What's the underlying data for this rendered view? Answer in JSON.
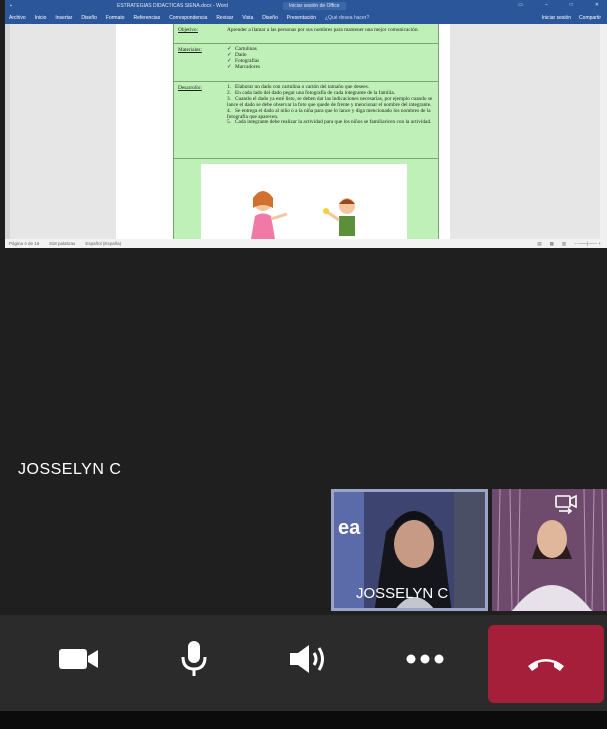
{
  "word": {
    "doc_title": "ESTRATEGIAS DIDACTICAS SIENA.docx - Word",
    "search_hint": "Iniciar sesión de Office",
    "tabs": [
      "Archivo",
      "Inicio",
      "Insertar",
      "Diseño",
      "Formato",
      "Referencias",
      "Correspondencia",
      "Revisar",
      "Vista",
      "Diseño",
      "Presentación"
    ],
    "tell_me": "¿Qué desea hacer?",
    "user_btn": "Iniciar sesión",
    "share_btn": "Compartir",
    "table": {
      "objective_label": "Objetivo:",
      "objective_text": "Aprender a llamar a las personas por sus nombres para mantener una mejor comunicación.",
      "materials_label": "Materiales:",
      "materials": [
        "Cartulinas",
        "Dado",
        "Fotografías",
        "Marcadores"
      ],
      "development_label": "Desarrollo:",
      "steps": [
        "Elaborar un dado con cartulina o cartón del tamaño que desees.",
        "En cada lado del dado pegar una fotografía de cada integrante de la familia.",
        "Cuando el dado ya esté listo, se deben dar las indicaciones necesarias, por ejemplo cuando se lance el dado se debe observar la foto que quede de frente y mencionar el nombre del integrante.",
        "Se entrega el dado al niño o a la niña para que lo lance y diga mencionado los nombres de la fotografía que aparecen.",
        "Cada integrante debe realizar la actividad para que los niños se familiaricen con la actividad."
      ]
    },
    "status": {
      "page": "Página 4 de 16",
      "words": "918 palabras",
      "language": "Español (España)"
    }
  },
  "call": {
    "caller_name": "JOSSELYN C",
    "self_tile_name": "JOSSELYN C"
  },
  "colors": {
    "hangup": "#a51e3a",
    "word_blue": "#2b579a",
    "table_green": "#bff0b7"
  }
}
